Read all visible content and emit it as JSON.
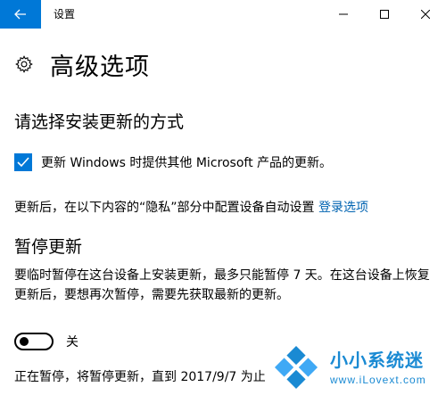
{
  "window": {
    "title": "设置"
  },
  "page": {
    "title": "高级选项"
  },
  "install_section": {
    "heading": "请选择安装更新的方式",
    "checkbox_label": "更新 Windows 时提供其他 Microsoft 产品的更新。",
    "checkbox_checked": true
  },
  "privacy_note": {
    "text": "更新后，在以下内容的“隐私”部分中配置设备自动设置 ",
    "link": "登录选项"
  },
  "pause_section": {
    "heading": "暂停更新",
    "description": "要临时暂停在这台设备上安装更新，最多只能暂停 7 天。在这台设备上恢复更新后，要想再次暂停，需要先获取最新的更新。",
    "toggle_label": "关",
    "toggle_on": false,
    "status": "正在暂停，将暂停更新，直到 2017/9/7 为止"
  },
  "watermark": {
    "title": "小小系统迷",
    "url": "www.iLovext.com"
  },
  "colors": {
    "accent": "#0078d7",
    "link": "#0063b1",
    "watermark": "#1a8ad3"
  }
}
